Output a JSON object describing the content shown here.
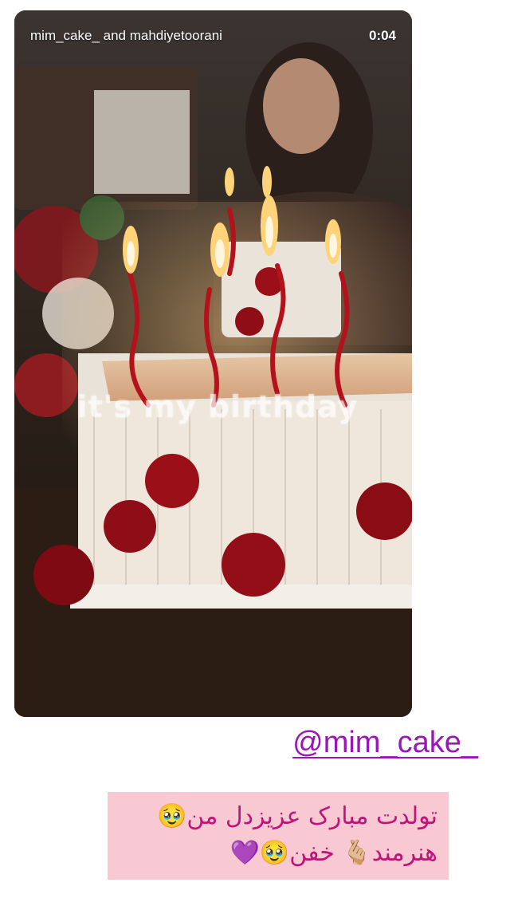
{
  "story": {
    "account": "mim_cake_ and mahdiyetoorani",
    "time": "0:04",
    "overlay_text": "it's my birthday"
  },
  "mention": "@mim_cake_",
  "message": {
    "line1": "تولدت مبارک عزیزدل من🥹",
    "line2": "هنرمند🫰🏼 خفن🥹💜"
  },
  "colors": {
    "mention": "#9b16b8",
    "message_text": "#c2127a",
    "message_bg": "#f8c9d2"
  }
}
